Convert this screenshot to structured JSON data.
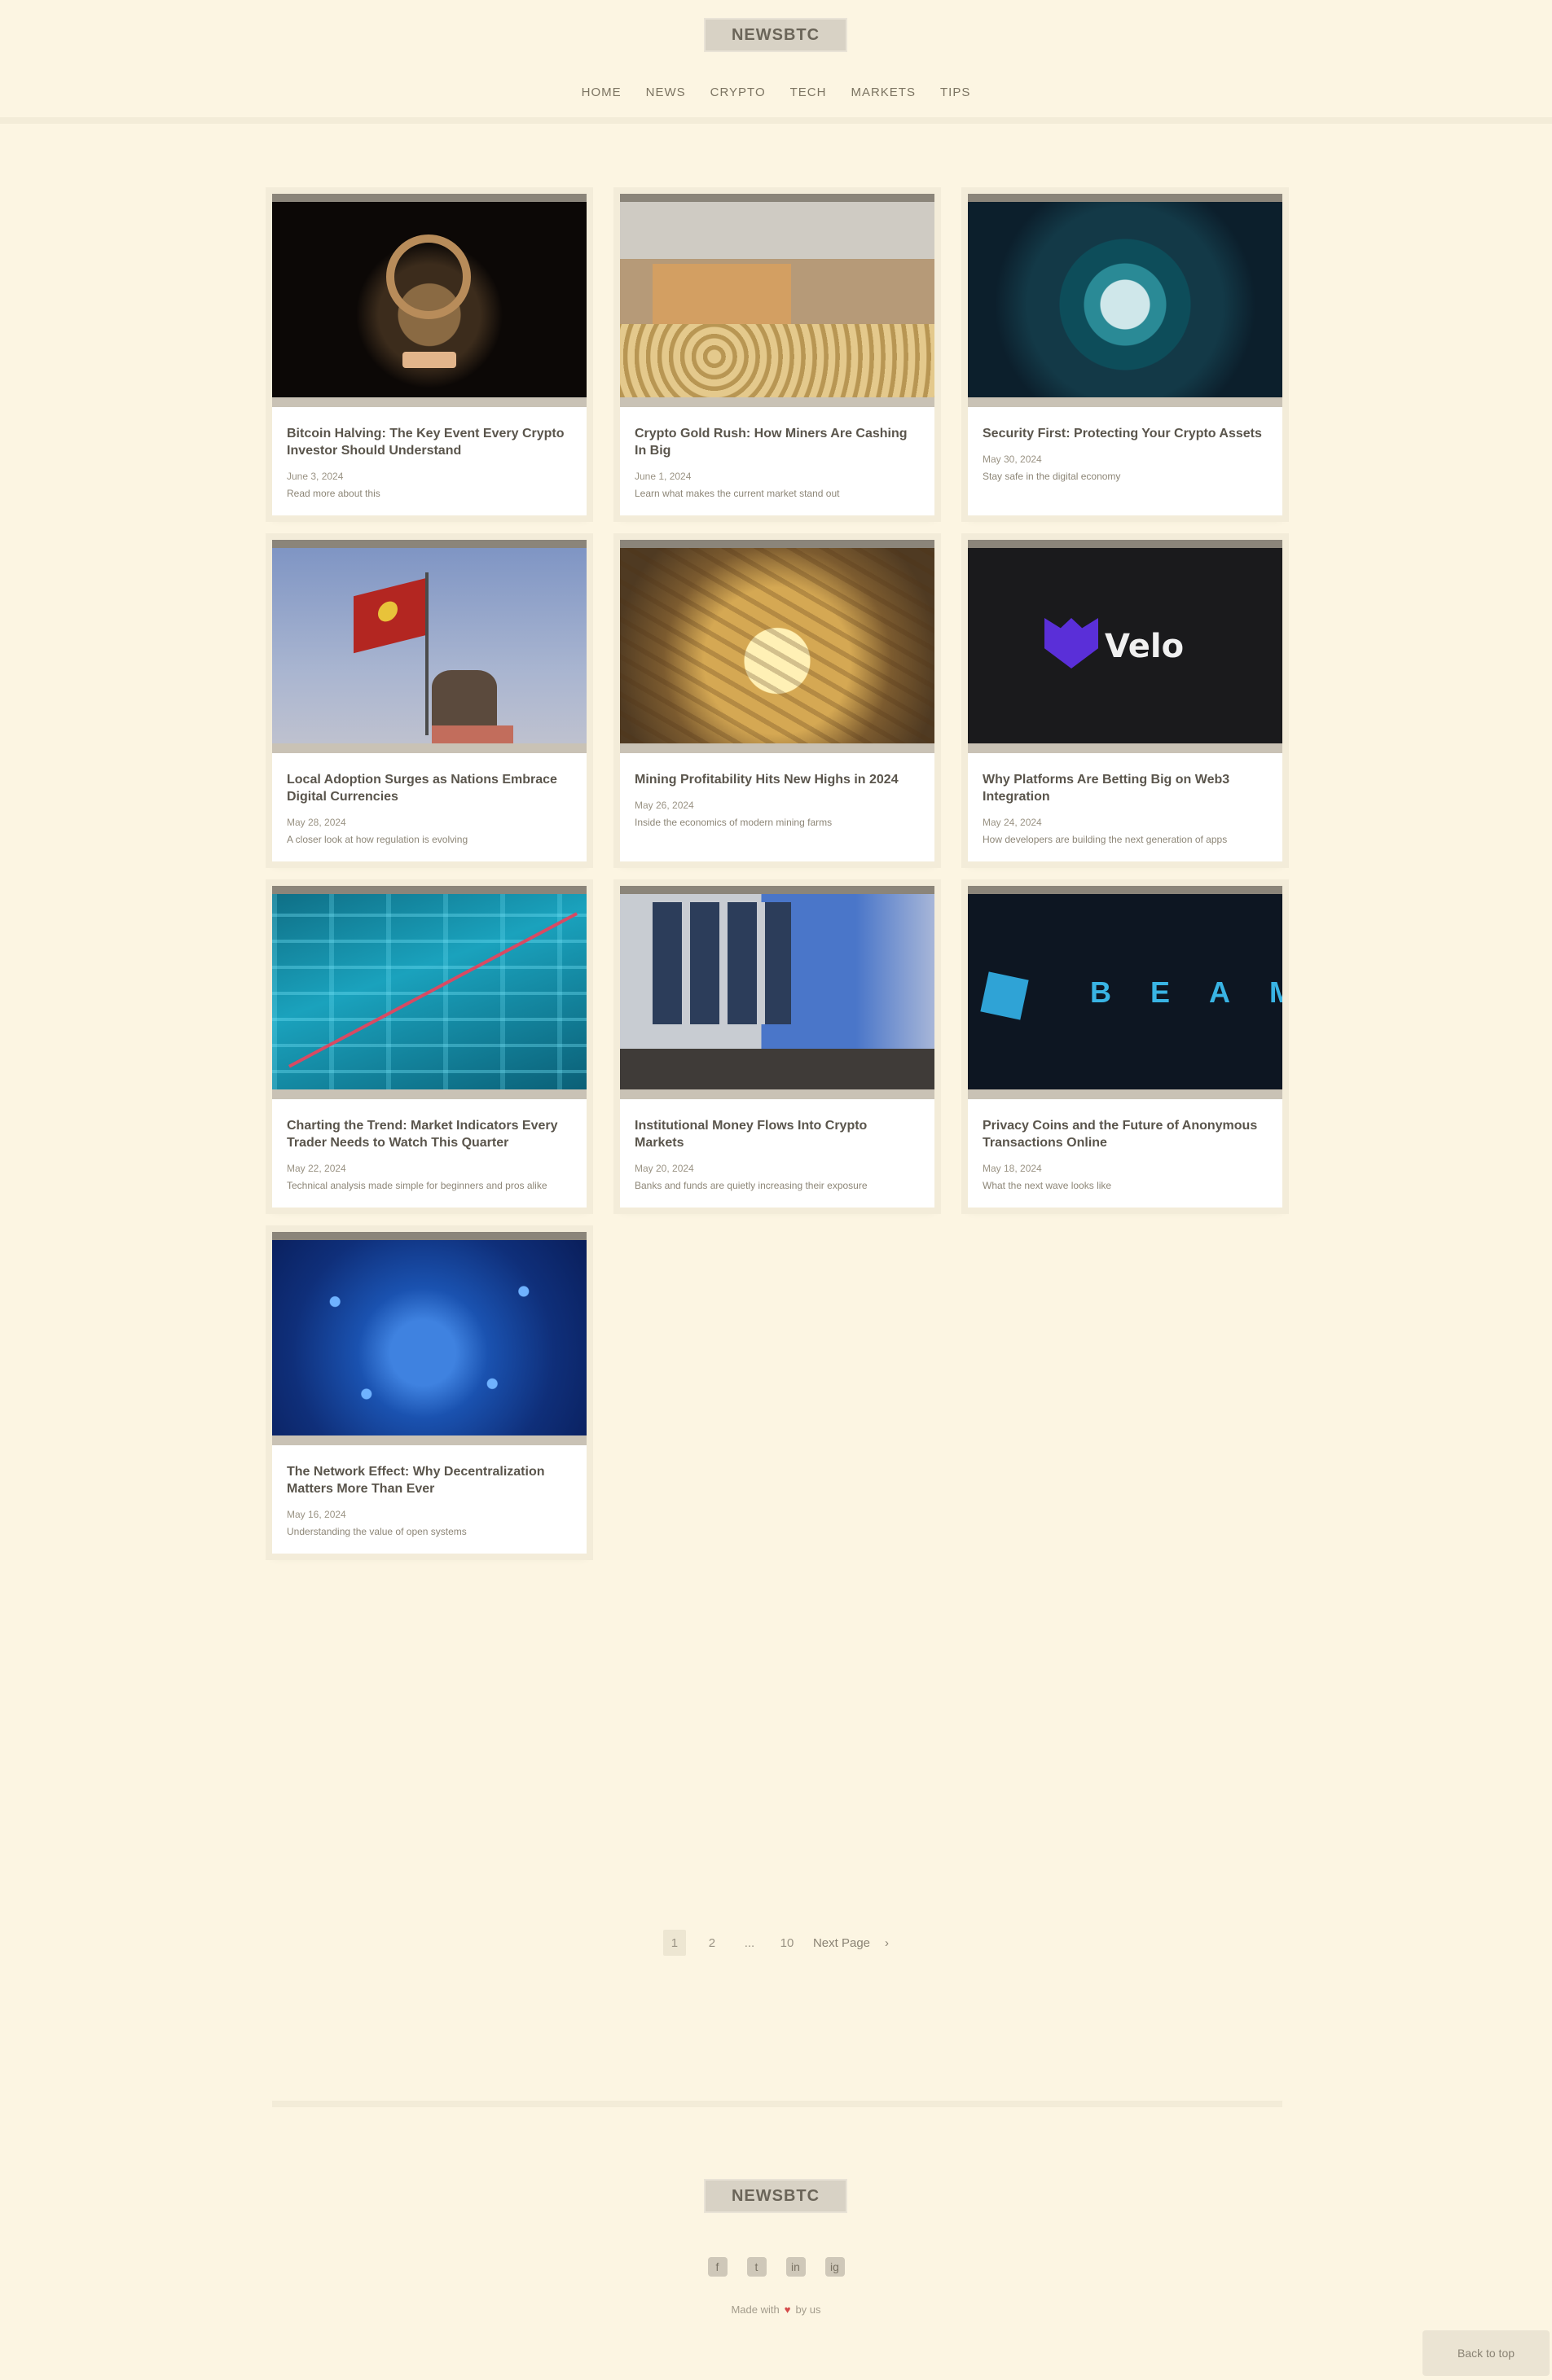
{
  "header": {
    "logo_text": "NEWSBTC",
    "nav": [
      "Home",
      "News",
      "Crypto",
      "Tech",
      "Markets",
      "Tips"
    ]
  },
  "posts": [
    {
      "title": "Bitcoin Halving: The Key Event Every Crypto Investor Should Understand",
      "meta": "June 3, 2024",
      "excerpt": "Read more about this"
    },
    {
      "title": "Crypto Gold Rush: How Miners Are Cashing In Big",
      "meta": "June 1, 2024",
      "excerpt": "Learn what makes the current market stand out"
    },
    {
      "title": "Security First: Protecting Your Crypto Assets",
      "meta": "May 30, 2024",
      "excerpt": "Stay safe in the digital economy"
    },
    {
      "title": "Local Adoption Surges as Nations Embrace Digital Currencies",
      "meta": "May 28, 2024",
      "excerpt": "A closer look at how regulation is evolving"
    },
    {
      "title": "Mining Profitability Hits New Highs in 2024",
      "meta": "May 26, 2024",
      "excerpt": "Inside the economics of modern mining farms"
    },
    {
      "title": "Why Platforms Are Betting Big on Web3 Integration",
      "meta": "May 24, 2024",
      "excerpt": "How developers are building the next generation of apps"
    },
    {
      "title": "Charting the Trend: Market Indicators Every Trader Needs to Watch This Quarter",
      "meta": "May 22, 2024",
      "excerpt": "Technical analysis made simple for beginners and pros alike"
    },
    {
      "title": "Institutional Money Flows Into Crypto Markets",
      "meta": "May 20, 2024",
      "excerpt": "Banks and funds are quietly increasing their exposure"
    },
    {
      "title": "Privacy Coins and the Future of Anonymous Transactions Online",
      "meta": "May 18, 2024",
      "excerpt": "What the next wave looks like"
    },
    {
      "title": "The Network Effect: Why Decentralization Matters More Than Ever",
      "meta": "May 16, 2024",
      "excerpt": "Understanding the value of open systems"
    }
  ],
  "pagination": {
    "pages": [
      "1",
      "2",
      "...",
      "10"
    ],
    "current_index": 0,
    "next_label": "Next Page"
  },
  "footer": {
    "logo_text": "NEWSBTC",
    "socials": [
      "f",
      "t",
      "in",
      "ig"
    ],
    "credit_prefix": "Made with",
    "credit_heart": "♥",
    "credit_suffix": "by us",
    "scroll_top_label": "Back to top"
  },
  "colors": {
    "page_background": "#fcf5e2",
    "card_background": "#ffffff",
    "accent_heart": "#d44a4a"
  }
}
